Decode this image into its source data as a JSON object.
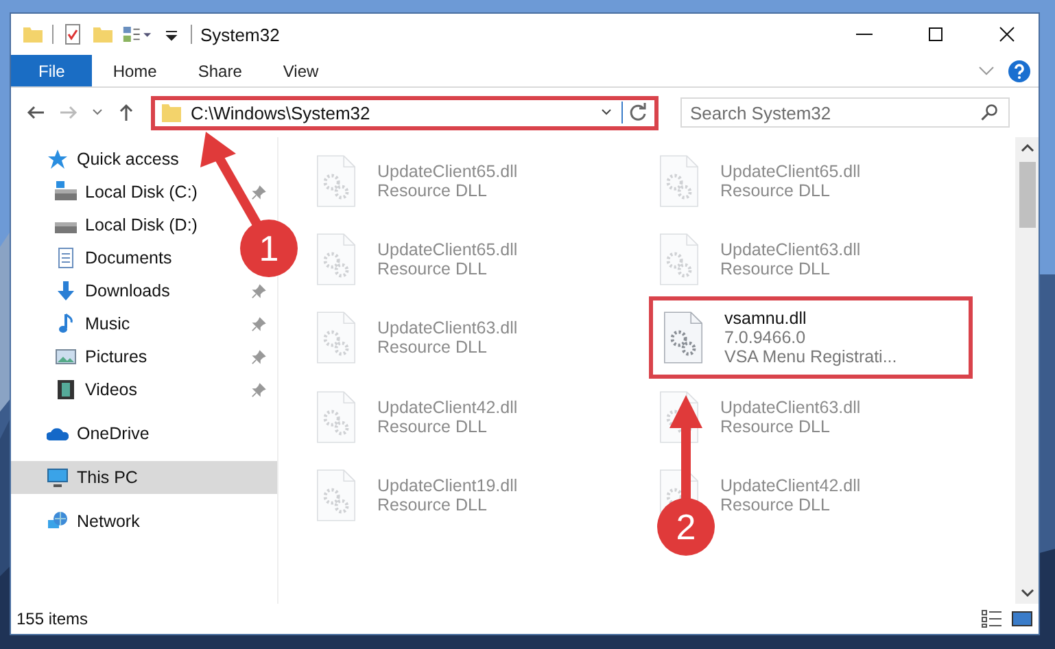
{
  "window": {
    "title": "System32"
  },
  "ribbon": {
    "tabs": [
      {
        "label": "File",
        "selected": true
      },
      {
        "label": "Home",
        "selected": false
      },
      {
        "label": "Share",
        "selected": false
      },
      {
        "label": "View",
        "selected": false
      }
    ]
  },
  "address": {
    "path": "C:\\Windows\\System32",
    "highlighted": true
  },
  "search": {
    "placeholder": "Search System32"
  },
  "sidebar": {
    "items": [
      {
        "label": "Quick access",
        "selected": false,
        "children": [
          {
            "label": "Local Disk (C:)",
            "pinned": true
          },
          {
            "label": "Local Disk (D:)",
            "pinned": false
          },
          {
            "label": "Documents",
            "pinned": false
          },
          {
            "label": "Downloads",
            "pinned": true
          },
          {
            "label": "Music",
            "pinned": true
          },
          {
            "label": "Pictures",
            "pinned": true
          },
          {
            "label": "Videos",
            "pinned": true
          }
        ]
      },
      {
        "label": "OneDrive",
        "selected": false
      },
      {
        "label": "This PC",
        "selected": true
      },
      {
        "label": "Network",
        "selected": false
      }
    ]
  },
  "files": [
    {
      "name": "UpdateClient65.dll",
      "description": "Resource DLL",
      "dimmed": true,
      "highlighted": false
    },
    {
      "name": "UpdateClient65.dll",
      "description": "Resource DLL",
      "dimmed": true,
      "highlighted": false
    },
    {
      "name": "UpdateClient65.dll",
      "description": "Resource DLL",
      "dimmed": true,
      "highlighted": false
    },
    {
      "name": "UpdateClient63.dll",
      "description": "Resource DLL",
      "dimmed": true,
      "highlighted": false
    },
    {
      "name": "UpdateClient63.dll",
      "description": "Resource DLL",
      "dimmed": true,
      "highlighted": false
    },
    {
      "name": "vsamnu.dll",
      "version": "7.0.9466.0",
      "description": "VSA Menu Registrati...",
      "dimmed": false,
      "highlighted": true
    },
    {
      "name": "UpdateClient42.dll",
      "description": "Resource DLL",
      "dimmed": true,
      "highlighted": false
    },
    {
      "name": "UpdateClient63.dll",
      "description": "Resource DLL",
      "dimmed": true,
      "highlighted": false
    },
    {
      "name": "UpdateClient19.dll",
      "description": "Resource DLL",
      "dimmed": true,
      "highlighted": false
    },
    {
      "name": "UpdateClient42.dll",
      "description": "Resource DLL",
      "dimmed": true,
      "highlighted": false
    }
  ],
  "status_bar": {
    "count": "155 items"
  },
  "callouts": [
    {
      "number": "1"
    },
    {
      "number": "2"
    }
  ]
}
